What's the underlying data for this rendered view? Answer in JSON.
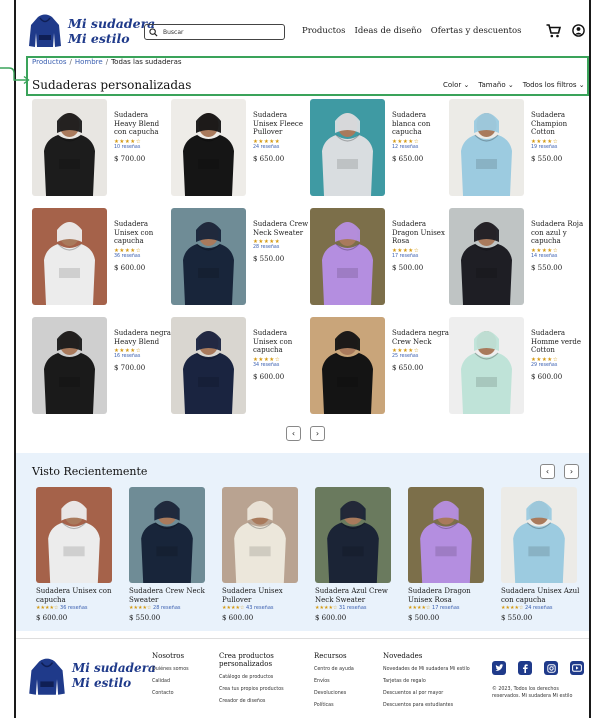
{
  "brand": {
    "line1": "Mi sudadera",
    "line2": "Mi estilo",
    "color": "#1f3a8a"
  },
  "search": {
    "placeholder": "Buscar"
  },
  "nav": [
    "Productos",
    "Ideas de diseño",
    "Ofertas y descuentos"
  ],
  "icons": {
    "cart": "cart-icon",
    "user": "user-icon",
    "search": "search-icon"
  },
  "breadcrumb": {
    "crumb1": "Productos",
    "crumb2": "Hombre",
    "current": "Todas las sudaderas",
    "separator": "/"
  },
  "page_title": "Sudaderas personalizadas",
  "filters": [
    "Color",
    "Tamaño",
    "Todos los filtros"
  ],
  "products": [
    {
      "name": "Sudadera Heavy Blend con capucha",
      "stars": "★★★★☆",
      "reviews": "10 reseñas",
      "price": "$ 700.00",
      "color": "#1c1c1c",
      "bg": "#e8e6e2"
    },
    {
      "name": "Sudadera Unisex Fleece Pullover",
      "stars": "★★★★★",
      "reviews": "24 reseñas",
      "price": "$ 650.00",
      "color": "#151515",
      "bg": "#eeece8"
    },
    {
      "name": "Sudadera blanca con capucha",
      "stars": "★★★★☆",
      "reviews": "12 reseñas",
      "price": "$ 650.00",
      "color": "#d9dde0",
      "bg": "#3f9aa3"
    },
    {
      "name": "Sudadera Champion Cotton",
      "stars": "★★★★☆",
      "reviews": "19 reseñas",
      "price": "$ 550.00",
      "color": "#9ccbe0",
      "bg": "#ecebe7"
    },
    {
      "name": "Sudadera Unisex con capucha",
      "stars": "★★★★☆",
      "reviews": "36 reseñas",
      "price": "$ 600.00",
      "color": "#ececec",
      "bg": "#a5624a"
    },
    {
      "name": "Sudadera Crew Neck Sweater",
      "stars": "★★★★★",
      "reviews": "28 reseñas",
      "price": "$ 550.00",
      "color": "#18253a",
      "bg": "#6f8c96"
    },
    {
      "name": "Sudadera Dragon Unisex Rosa",
      "stars": "★★★★☆",
      "reviews": "17 reseñas",
      "price": "$ 500.00",
      "color": "#b48ee0",
      "bg": "#7c6f4a"
    },
    {
      "name": "Sudadera Roja con azul y capucha",
      "stars": "★★★★☆",
      "reviews": "14 reseñas",
      "price": "$ 550.00",
      "color": "#1e1e24",
      "bg": "#bfc4c4"
    },
    {
      "name": "Sudadera negra Heavy Blend",
      "stars": "★★★★☆",
      "reviews": "16 reseñas",
      "price": "$ 700.00",
      "color": "#1a1a1a",
      "bg": "#cfcfcf"
    },
    {
      "name": "Sudadera Unisex con capucha",
      "stars": "★★★★☆",
      "reviews": "34 reseñas",
      "price": "$ 600.00",
      "color": "#1a2440",
      "bg": "#d9d6d0"
    },
    {
      "name": "Sudadera negra Crew Neck",
      "stars": "★★★★☆",
      "reviews": "25 reseñas",
      "price": "$ 650.00",
      "color": "#141414",
      "bg": "#c9a57a"
    },
    {
      "name": "Sudadera Homme verde Cotton",
      "stars": "★★★★☆",
      "reviews": "29 reseñas",
      "price": "$ 600.00",
      "color": "#bfe3d8",
      "bg": "#eeeeee"
    }
  ],
  "pager": {
    "prev": "‹",
    "next": "›"
  },
  "recent": {
    "title": "Visto Recientemente",
    "items": [
      {
        "name": "Sudadera Unisex con capucha",
        "stars": "★★★★☆",
        "reviews": "36 reseñas",
        "price": "$ 600.00",
        "color": "#ececec",
        "bg": "#a5624a"
      },
      {
        "name": "Sudadera Crew Neck Sweater",
        "stars": "★★★★☆",
        "reviews": "28 reseñas",
        "price": "$ 550.00",
        "color": "#18253a",
        "bg": "#6f8c96"
      },
      {
        "name": "Sudadera Unisex Pullover",
        "stars": "★★★★☆",
        "reviews": "43 reseñas",
        "price": "$ 600.00",
        "color": "#ece7db",
        "bg": "#b9a391"
      },
      {
        "name": "Sudadera Azul Crew Neck Sweater",
        "stars": "★★★★☆",
        "reviews": "31 reseñas",
        "price": "$ 600.00",
        "color": "#1b2436",
        "bg": "#6a7a5e"
      },
      {
        "name": "Sudadera Dragon Unisex Rosa",
        "stars": "★★★★☆",
        "reviews": "17 reseñas",
        "price": "$ 500.00",
        "color": "#b48ee0",
        "bg": "#7c6f4a"
      },
      {
        "name": "Sudadera Unisex Azul con capucha",
        "stars": "★★★★☆",
        "reviews": "24 reseñas",
        "price": "$ 550.00",
        "color": "#9ccbe0",
        "bg": "#ecebe7"
      }
    ]
  },
  "footer": {
    "col1": {
      "title": "Nosotros",
      "items": [
        "Quiénes somos",
        "Calidad",
        "Contacto"
      ]
    },
    "col2": {
      "title": "Crea productos personalizados",
      "items": [
        "Catálogo de productos",
        "Crea tus propios productos",
        "Creador de diseños"
      ]
    },
    "col3": {
      "title": "Recursos",
      "items": [
        "Centro de ayuda",
        "Envíos",
        "Devoluciones",
        "Políticas"
      ]
    },
    "col4": {
      "title": "Novedades",
      "items": [
        "Novedades de Mi sudadera Mi estilo",
        "Tarjetas de regalo",
        "Descuentos al por mayor",
        "Descuentos para estudiantes"
      ]
    },
    "social": [
      "twitter-icon",
      "facebook-icon",
      "instagram-icon",
      "youtube-icon"
    ],
    "copyright": "© 2023, Todos los derechos reservados. Mi sudadera Mi estilo"
  },
  "highlight_color": "#3aa35a"
}
